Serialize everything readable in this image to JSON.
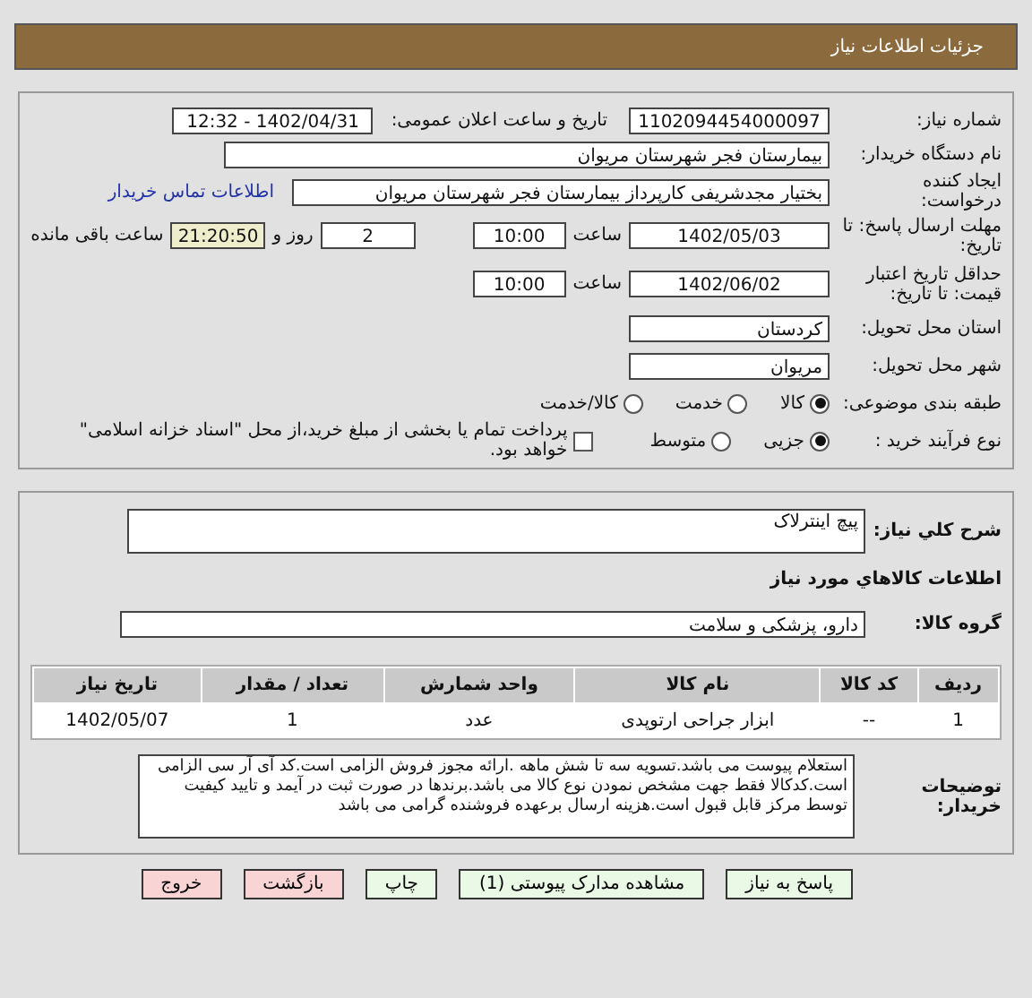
{
  "header": {
    "title": "جزئیات اطلاعات نیاز"
  },
  "need_info": {
    "need_number": {
      "label": "شماره نیاز:",
      "value": "1102094454000097"
    },
    "announce_datetime": {
      "label": "تاریخ و ساعت اعلان عمومی:",
      "value": "1402/04/31 - 12:32"
    },
    "buyer_org": {
      "label": "نام دستگاه خریدار:",
      "value": "بیمارستان فجر شهرستان مریوان"
    },
    "requester": {
      "label": "ایجاد کننده درخواست:",
      "value": "بختیار مجدشریفی کارپرداز بیمارستان فجر شهرستان مریوان",
      "link": "اطلاعات تماس خریدار"
    },
    "reply_deadline": {
      "label": "مهلت ارسال پاسخ: تا تاریخ:",
      "date": "1402/05/03",
      "time_label": "ساعت",
      "time": "10:00",
      "days": "2",
      "days_label": "روز و",
      "remaining": "21:20:50",
      "remaining_label": "ساعت باقی مانده"
    },
    "price_validity": {
      "label": "حداقل تاریخ اعتبار قیمت: تا تاریخ:",
      "date": "1402/06/02",
      "time_label": "ساعت",
      "time": "10:00"
    },
    "province": {
      "label": "استان محل تحویل:",
      "value": "کردستان"
    },
    "city": {
      "label": "شهر محل تحویل:",
      "value": "مریوان"
    },
    "category": {
      "label": "طبقه بندی موضوعی:",
      "options": [
        {
          "label": "کالا",
          "selected": true
        },
        {
          "label": "خدمت",
          "selected": false
        },
        {
          "label": "کالا/خدمت",
          "selected": false
        }
      ]
    },
    "purchase_process": {
      "label": "نوع فرآیند خرید :",
      "options": [
        {
          "label": "جزیی",
          "selected": true
        },
        {
          "label": "متوسط",
          "selected": false
        }
      ],
      "treasury_payment": {
        "label": "پرداخت تمام یا بخشی از مبلغ خرید،از محل \"اسناد خزانه اسلامی\" خواهد بود.",
        "checked": false
      }
    }
  },
  "goods": {
    "description": {
      "label": "شرح کلي نياز:",
      "value": "پیچ اینترلاک"
    },
    "section_title": "اطلاعات کالاهاي مورد نياز",
    "group": {
      "label": "گروه کالا:",
      "value": "دارو، پزشکی و سلامت"
    },
    "table": {
      "columns": [
        "ردیف",
        "کد کالا",
        "نام کالا",
        "واحد شمارش",
        "تعداد / مقدار",
        "تاریخ نیاز"
      ],
      "rows": [
        [
          "1",
          "--",
          "ابزار جراحی ارتوپدی",
          "عدد",
          "1",
          "1402/05/07"
        ]
      ]
    },
    "buyer_notes": {
      "label": "توضیحات خریدار:",
      "value": "استعلام پیوست می باشد.تسویه سه تا شش ماهه .ارائه مجوز فروش  الزامی است.کد آی آر سی الزامی است.کدکالا فقط جهت مشخص نمودن نوع کالا می باشد.برندها در صورت ثبت در آیمد و تایید کیفیت توسط مرکز قابل قبول است.هزینه ارسال برعهده فروشنده گرامی می باشد"
    }
  },
  "buttons": [
    {
      "label": "پاسخ به نیاز",
      "kind": "action"
    },
    {
      "label": "مشاهده مدارک پیوستی (1)",
      "kind": "action"
    },
    {
      "label": "چاپ",
      "kind": "action"
    },
    {
      "label": "بازگشت",
      "kind": "danger"
    },
    {
      "label": "خروج",
      "kind": "danger"
    }
  ]
}
